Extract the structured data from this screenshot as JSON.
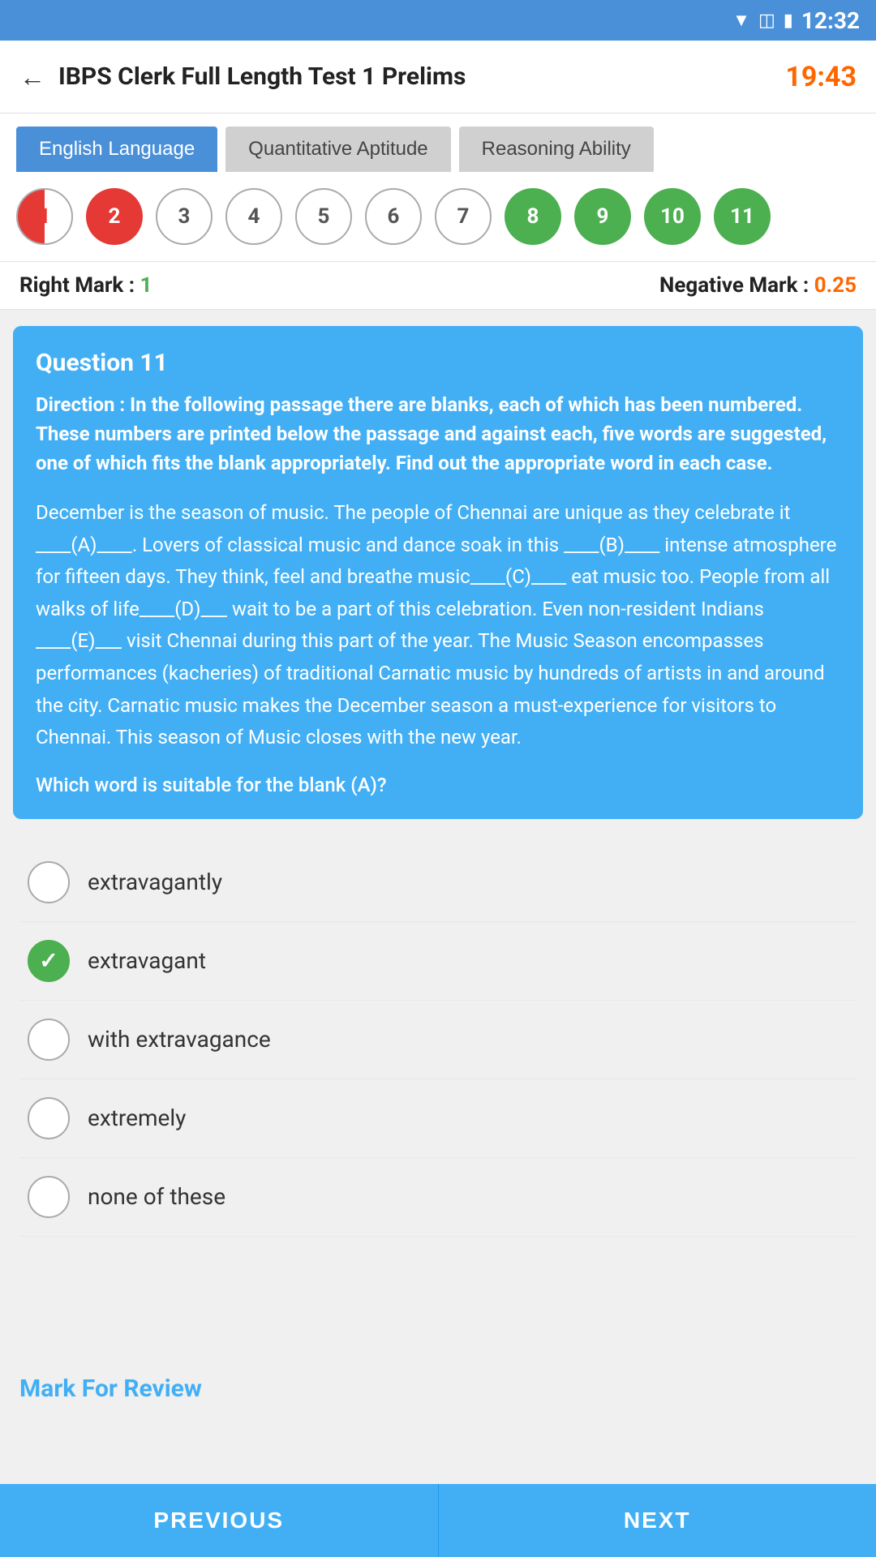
{
  "statusBar": {
    "time": "12:32"
  },
  "header": {
    "title": "IBPS Clerk Full Length Test 1 Prelims",
    "timer": "19:43",
    "backLabel": "←"
  },
  "tabs": [
    {
      "id": "english",
      "label": "English Language",
      "active": true
    },
    {
      "id": "quantitative",
      "label": "Quantitative Aptitude",
      "active": false
    },
    {
      "id": "reasoning",
      "label": "Reasoning Ability",
      "active": false
    }
  ],
  "questionNumbers": [
    {
      "num": "1",
      "style": "partial"
    },
    {
      "num": "2",
      "style": "red"
    },
    {
      "num": "3",
      "style": "default"
    },
    {
      "num": "4",
      "style": "default"
    },
    {
      "num": "5",
      "style": "default"
    },
    {
      "num": "6",
      "style": "default"
    },
    {
      "num": "7",
      "style": "default"
    },
    {
      "num": "8",
      "style": "green"
    },
    {
      "num": "9",
      "style": "green"
    },
    {
      "num": "10",
      "style": "green"
    },
    {
      "num": "11",
      "style": "green"
    }
  ],
  "marks": {
    "rightLabel": "Right Mark : ",
    "rightValue": "1",
    "negativeLabel": "Negative Mark : ",
    "negativeValue": "0.25"
  },
  "question": {
    "numberLabel": "Question 11",
    "directionLabel": "Direction : In the following passage there are blanks, each of which has been numbered. These numbers are printed below the passage and against each, five words are suggested, one of which fits the blank appropriately. Find out the appropriate word in each case.",
    "passage": "December is the season of music. The people of Chennai are unique as they celebrate it ____(A)____. Lovers of classical music and dance soak in this ____(B)____ intense atmosphere for fifteen days. They think, feel and breathe music____(C)____ eat music too. People from all walks of life____(D)___ wait to be a part of this celebration. Even non-resident Indians ____(E)___ visit Chennai during this part of the year. The Music Season encompasses performances (kacheries) of traditional Carnatic music by hundreds of artists in and around the city. Carnatic music makes the December season a must-experience for visitors to Chennai. This season of Music closes with the new year.",
    "prompt": "Which word is suitable for the blank (A)?"
  },
  "options": [
    {
      "id": "A",
      "text": "extravagantly",
      "selected": false
    },
    {
      "id": "B",
      "text": "extravagant",
      "selected": true
    },
    {
      "id": "C",
      "text": "with extravagance",
      "selected": false
    },
    {
      "id": "D",
      "text": "extremely",
      "selected": false
    },
    {
      "id": "E",
      "text": "none of these",
      "selected": false
    }
  ],
  "markForReview": {
    "label": "Mark For Review"
  },
  "bottomNav": {
    "previous": "PREVIOUS",
    "next": "NEXT"
  }
}
